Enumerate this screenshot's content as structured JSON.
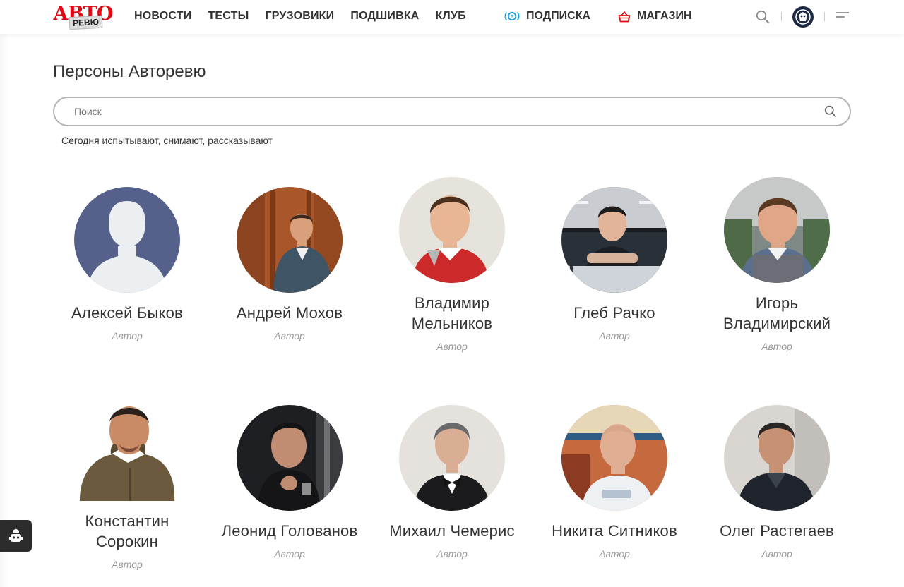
{
  "header": {
    "logo": {
      "top": "АВТО",
      "bottom": "РЕВЮ"
    },
    "nav": [
      "НОВОСТИ",
      "ТЕСТЫ",
      "ГРУЗОВИКИ",
      "ПОДШИВКА",
      "КЛУБ"
    ],
    "subscription_label": "ПОДПИСКА",
    "shop_label": "МАГАЗИН",
    "icons": [
      "search-icon",
      "user-avatar",
      "menu-icon"
    ]
  },
  "page_title": "Персоны Авторевю",
  "search": {
    "placeholder": "Поиск"
  },
  "subtitle": "Сегодня испытывают, снимают, рассказывают",
  "persons": [
    {
      "name_lines": [
        "Алексей Быков"
      ],
      "role": "Автор"
    },
    {
      "name_lines": [
        "Андрей Мохов"
      ],
      "role": "Автор"
    },
    {
      "name_lines": [
        "Владимир",
        "Мельников"
      ],
      "role": "Автор"
    },
    {
      "name_lines": [
        "Глеб Рачко"
      ],
      "role": "Автор"
    },
    {
      "name_lines": [
        "Игорь",
        "Владимирский"
      ],
      "role": "Автор"
    },
    {
      "name_lines": [
        "Константин",
        "Сорокин"
      ],
      "role": "Автор"
    },
    {
      "name_lines": [
        "Леонид Голованов"
      ],
      "role": "Автор"
    },
    {
      "name_lines": [
        "Михаил Чемерис"
      ],
      "role": "Автор"
    },
    {
      "name_lines": [
        "Никита Ситников"
      ],
      "role": "Автор"
    },
    {
      "name_lines": [
        "Олег Растегаев"
      ],
      "role": "Автор"
    }
  ],
  "colors": {
    "brand": "#e30613",
    "subscription": "#1fa2e0",
    "shop": "#e30613",
    "placeholder_avatar": "#55618a"
  }
}
